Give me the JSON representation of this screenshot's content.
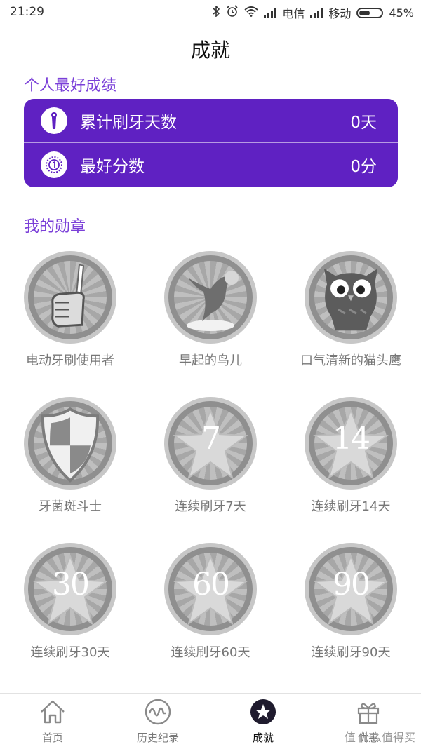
{
  "status": {
    "time": "21:29",
    "carrier1": "电信",
    "carrier2": "移动",
    "battery": "45%",
    "battery_level": 0.45
  },
  "page_title": "成就",
  "personal_best": {
    "title": "个人最好成绩",
    "rows": [
      {
        "icon": "toothbrush-icon",
        "label": "累计刷牙天数",
        "value": "0天"
      },
      {
        "icon": "ribbon-medal-icon",
        "label": "最好分数",
        "value": "0分"
      }
    ]
  },
  "medals": {
    "title": "我的勋章",
    "items": [
      {
        "label": "电动牙刷使用者",
        "icon": "thumbs-up-toothbrush-icon"
      },
      {
        "label": "早起的鸟儿",
        "icon": "bird-icon"
      },
      {
        "label": "口气清新的猫头鹰",
        "icon": "owl-icon"
      },
      {
        "label": "牙菌斑斗士",
        "icon": "shield-icon"
      },
      {
        "label": "连续刷牙7天",
        "icon": "star-icon",
        "number": "7"
      },
      {
        "label": "连续刷牙14天",
        "icon": "star-icon",
        "number": "14"
      },
      {
        "label": "连续刷牙30天",
        "icon": "star-icon",
        "number": "30"
      },
      {
        "label": "连续刷牙60天",
        "icon": "star-icon",
        "number": "60"
      },
      {
        "label": "连续刷牙90天",
        "icon": "star-icon",
        "number": "90"
      }
    ]
  },
  "nav": {
    "items": [
      {
        "label": "首页",
        "icon": "home-icon"
      },
      {
        "label": "历史纪录",
        "icon": "history-wave-icon"
      },
      {
        "label": "成就",
        "icon": "star-circle-icon",
        "active": true
      },
      {
        "label": "优惠",
        "icon": "gift-icon"
      }
    ]
  },
  "watermark": "值 什么值得买",
  "colors": {
    "accent": "#5f21c2",
    "section_title": "#7a3fd8",
    "medal_gray": "#bfbfbf"
  }
}
